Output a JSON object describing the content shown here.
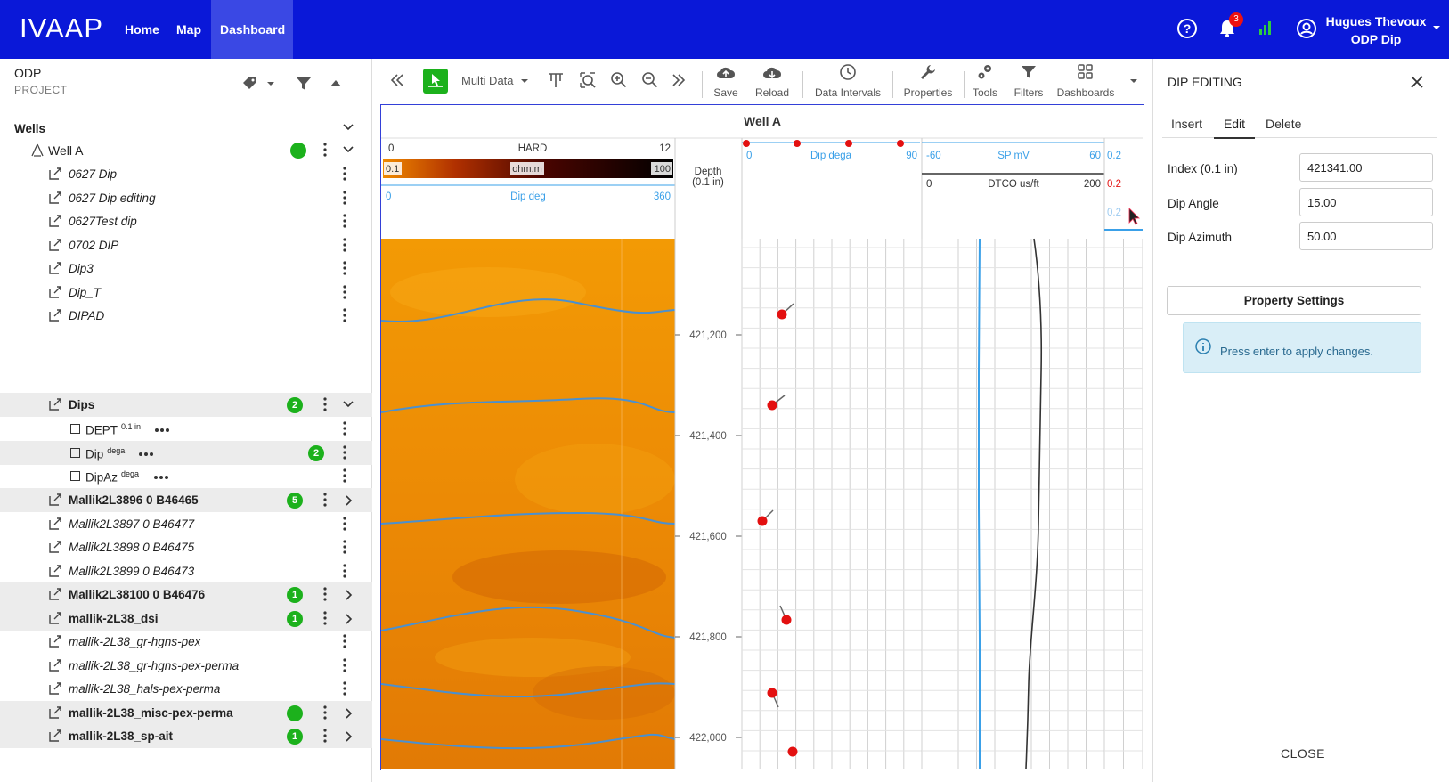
{
  "app": {
    "logo": "IVAAP",
    "nav": [
      "Home",
      "Map",
      "Dashboard"
    ],
    "notification_count": "3",
    "user_name": "Hugues Thevoux",
    "user_sub": "ODP Dip"
  },
  "project": {
    "name": "ODP",
    "label": "PROJECT"
  },
  "tree": {
    "section": "Wells",
    "well": "Well A",
    "well_items": [
      "0627 Dip",
      "0627 Dip editing",
      "0627Test dip",
      "0702 DIP",
      "Dip3",
      "Dip_T",
      "DIPAD"
    ],
    "dips": {
      "label": "Dips",
      "badge": "2",
      "children": [
        {
          "name": "DEPT",
          "unit": "0.1 in"
        },
        {
          "name": "Dip",
          "unit": "dega",
          "badge": "2"
        },
        {
          "name": "DipAz",
          "unit": "dega"
        }
      ]
    },
    "others": [
      {
        "label": "Mallik2L3896 0 B46465",
        "bold": true,
        "badge": "5"
      },
      {
        "label": "Mallik2L3897 0 B46477",
        "bold": false
      },
      {
        "label": "Mallik2L3898 0 B46475",
        "bold": false
      },
      {
        "label": "Mallik2L3899 0 B46473",
        "bold": false
      },
      {
        "label": "Mallik2L38100 0 B46476",
        "bold": true,
        "badge": "1"
      },
      {
        "label": "mallik-2L38_dsi",
        "bold": true,
        "badge": "1"
      },
      {
        "label": "mallik-2L38_gr-hgns-pex",
        "bold": false
      },
      {
        "label": "mallik-2L38_gr-hgns-pex-perma",
        "bold": false
      },
      {
        "label": "mallik-2L38_hals-pex-perma",
        "bold": false
      },
      {
        "label": "mallik-2L38_misc-pex-perma",
        "bold": true,
        "badge": ""
      },
      {
        "label": "mallik-2L38_sp-ait",
        "bold": true,
        "badge": "1"
      }
    ]
  },
  "toolbar": {
    "multi": "Multi Data",
    "save": "Save",
    "reload": "Reload",
    "intervals": "Data Intervals",
    "properties": "Properties",
    "tools": "Tools",
    "filters": "Filters",
    "dashboards": "Dashboards"
  },
  "plot": {
    "title": "Well A",
    "track1": {
      "hard_min": "0",
      "hard_label": "HARD",
      "hard_max": "12",
      "res_min": "0.1",
      "res_unit": "ohm.m",
      "res_max": "100",
      "dip_min": "0",
      "dip_label": "Dip  deg",
      "dip_max": "360"
    },
    "depth_header": "Depth",
    "depth_unit": "(0.1 in)",
    "depth_ticks": [
      "421,200",
      "421,400",
      "421,600",
      "421,800",
      "422,000"
    ],
    "track3": {
      "min": "0",
      "label": "Dip  dega",
      "max": "90"
    },
    "track4": {
      "sp_min": "-60",
      "sp_label": "SP  mV",
      "sp_max": "60",
      "dt_min": "0",
      "dt_label": "DTCO  us/ft",
      "dt_max": "200",
      "edge1": "0.2",
      "edge2": "0.2",
      "edge3": "0.2"
    }
  },
  "colors": {
    "nav_blue": "#0a18d8",
    "accent_green": "#1cb11c",
    "curve_blue": "#3aa0e8",
    "dip_red": "#e31010"
  },
  "dip_editing": {
    "title": "DIP EDITING",
    "tabs": [
      "Insert",
      "Edit",
      "Delete"
    ],
    "active_tab": "Edit",
    "fields": [
      {
        "label": "Index (0.1 in)",
        "value": "421341.00"
      },
      {
        "label": "Dip Angle",
        "value": "15.00"
      },
      {
        "label": "Dip Azimuth",
        "value": "50.00"
      }
    ],
    "property_settings": "Property Settings",
    "info": "Press enter to apply changes.",
    "close": "CLOSE"
  }
}
